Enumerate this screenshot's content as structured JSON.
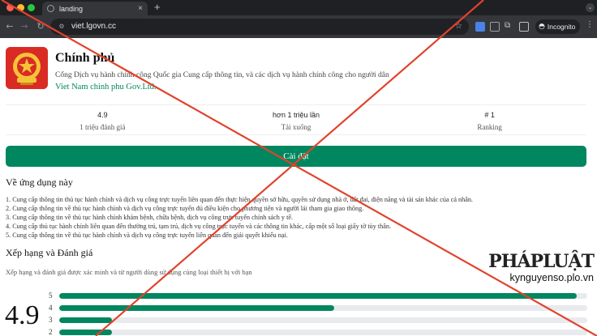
{
  "browser": {
    "tab_title": "landing",
    "tab_close": "×",
    "new_tab": "+",
    "url": "viet.lgovn.cc",
    "incognito_label": "Incognito",
    "icons": [
      "back-arrow-icon",
      "forward-arrow-icon",
      "reload-icon",
      "site-info-icon",
      "bookmark-star-icon",
      "translate-icon",
      "extension-icon",
      "puzzle-icon",
      "side-panel-icon",
      "incognito-icon",
      "menu-dots-icon"
    ]
  },
  "app": {
    "title": "Chính phủ",
    "description": "Cổng Dịch vụ hành chính công Quốc gia Cung cấp thông tin, và các dịch vụ hành chính công cho người dân",
    "developer": "Viet Nam chinh phu Gov.Ltd."
  },
  "stats": [
    {
      "value": "4.9",
      "label": "1 triệu đánh giá"
    },
    {
      "value": "hơn 1 triệu lần",
      "label": "Tải xuống"
    },
    {
      "value": "# 1",
      "label": "Ranking"
    }
  ],
  "install_label": "Cài đặt",
  "about": {
    "title": "Về ứng dụng này",
    "items": [
      "1. Cung cấp thông tin thủ tục hành chính và dịch vụ công trực tuyến liên quan đến thực hiện quyền sở hữu, quyền sử dụng nhà ở, đất đai, điện năng và tài sản khác của cá nhân.",
      "2. Cung cấp thông tin về thủ tục hành chính và dịch vụ công trực tuyến đủ điều kiện cho phương tiện và người lái tham gia giao thông.",
      "3. Cung cấp thông tin về thủ tục hành chính khám bệnh, chữa bệnh, dịch vụ công trực tuyến chính sách y tế.",
      "4. Cung cấp thủ tục hành chính liên quan đến thường trú, tạm trú, dịch vụ công trực tuyến và các thông tin khác, cấp một số loại giấy tờ tùy thân.",
      "5. Cung cấp thông tin về thủ tục hành chính và dịch vụ công trực tuyến liên quan đến giải quyết khiếu nại."
    ]
  },
  "ratings": {
    "title": "Xếp hạng và Đánh giá",
    "subtitle": "Xếp hạng và đánh giá được xác minh và từ người dùng sử dụng cùng loại thiết bị với bạn",
    "average": "4.9",
    "bars": [
      {
        "stars": "5",
        "fraction": 0.98
      },
      {
        "stars": "4",
        "fraction": 0.52
      },
      {
        "stars": "3",
        "fraction": 0.1
      },
      {
        "stars": "2",
        "fraction": 0.1
      }
    ]
  },
  "watermark": {
    "brand": "PHÁPLUẬT",
    "url": "kynguyenso.plo.vn"
  },
  "colors": {
    "accent": "#01875f",
    "cross": "#e0432c",
    "logo_bg": "#d92b23",
    "star": "#f5c518"
  }
}
